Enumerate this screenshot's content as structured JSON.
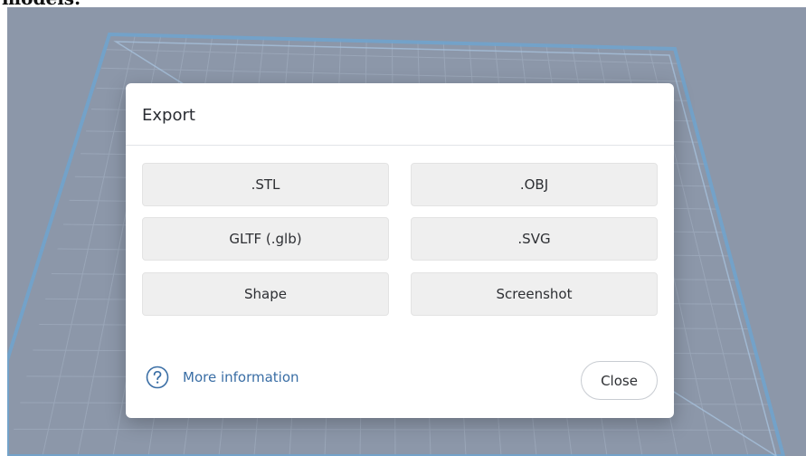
{
  "background_text": "models.",
  "dialog": {
    "title": "Export",
    "export_options": [
      {
        "label": ".STL"
      },
      {
        "label": ".OBJ"
      },
      {
        "label": "GLTF (.glb)"
      },
      {
        "label": ".SVG"
      },
      {
        "label": "Shape"
      },
      {
        "label": "Screenshot"
      }
    ],
    "more_info_label": "More information",
    "close_label": "Close"
  },
  "icons": {
    "help": "question-circle-icon"
  },
  "colors": {
    "viewport_background": "#8c97a9",
    "grid_line": "#9aa6b8",
    "plate_edge": "#6fa3cf",
    "dialog_background": "#ffffff",
    "option_button_background": "#efefef",
    "link_color": "#3a6ea5"
  }
}
